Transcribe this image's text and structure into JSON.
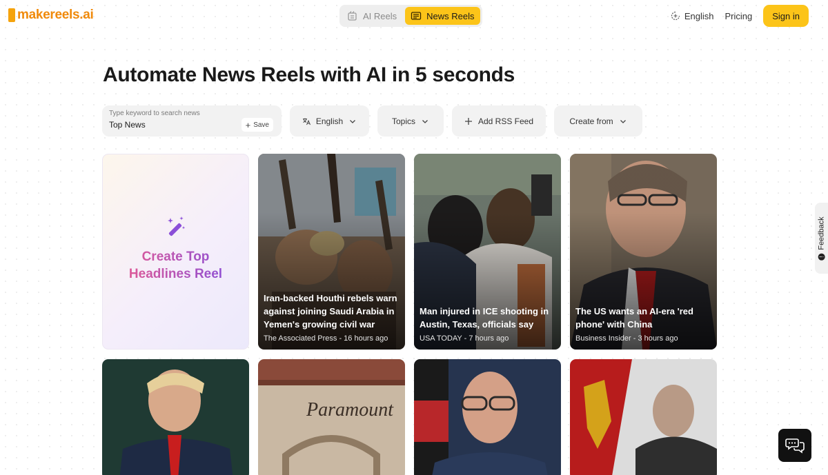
{
  "header": {
    "logo_text": "makereels.ai",
    "mode_tabs": [
      {
        "label": "AI Reels",
        "active": false
      },
      {
        "label": "News Reels",
        "active": true
      }
    ],
    "language_label": "English",
    "pricing_label": "Pricing",
    "signin_label": "Sign in"
  },
  "page": {
    "title": "Automate News Reels with AI in 5 seconds"
  },
  "filters": {
    "search_placeholder": "Type keyword to search news",
    "search_value": "Top News",
    "save_label": "Save",
    "language": "English",
    "topics": "Topics",
    "add_rss": "Add RSS Feed",
    "create_from": "Create from"
  },
  "create_card": {
    "label": "Create Top Headlines Reel"
  },
  "news": [
    {
      "title": "Iran-backed Houthi rebels warn against joining Saudi Arabia in Yemen's growing civil war",
      "meta": "The Associated Press - 16 hours ago"
    },
    {
      "title": "Man injured in ICE shooting in Austin, Texas, officials say",
      "meta": "USA TODAY - 7 hours ago"
    },
    {
      "title": "The US wants an AI-era 'red phone' with China",
      "meta": "Business Insider - 3 hours ago"
    }
  ],
  "bottom_cards": [
    {
      "image_text": "Paramount"
    }
  ],
  "feedback_label": "Feedback",
  "colors": {
    "accent": "#fcc419",
    "logo": "#f08a0b",
    "create_gradient_start": "#e35a93",
    "create_gradient_end": "#8b4fd8"
  },
  "icons": {
    "ai_reels": "film-icon",
    "news_reels": "newspaper-icon",
    "language": "translate-icon",
    "add": "plus-icon",
    "create": "magic-wand-icon",
    "chat": "chat-bubbles-icon"
  }
}
